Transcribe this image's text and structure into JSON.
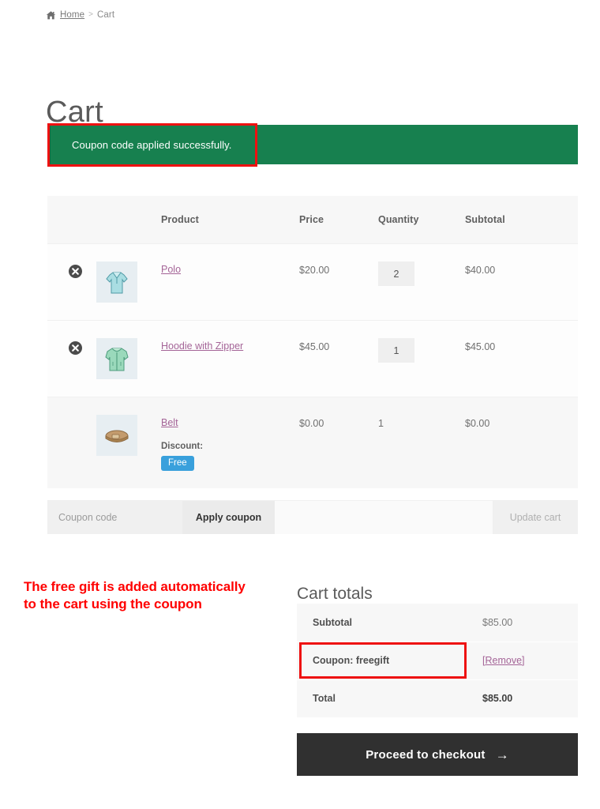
{
  "breadcrumb": {
    "home_label": "Home",
    "separator": ">",
    "current_label": "Cart"
  },
  "page_title": "Cart",
  "notice": {
    "message": "Coupon code applied successfully.",
    "background_color": "#17804f"
  },
  "annotation": {
    "text": "The free gift is added automatically to the cart using the coupon",
    "color": "#ff0000",
    "box_color": "#ee1111"
  },
  "cart_table": {
    "headers": {
      "remove": "",
      "thumbnail": "",
      "product": "Product",
      "price": "Price",
      "quantity": "Quantity",
      "subtotal": "Subtotal"
    },
    "rows": [
      {
        "name": "Polo",
        "price": "$20.00",
        "quantity": "2",
        "subtotal": "$40.00",
        "removable": true,
        "discount_label": "",
        "badge": "",
        "thumb_color": "#9ed8dd"
      },
      {
        "name": "Hoodie with Zipper",
        "price": "$45.00",
        "quantity": "1",
        "subtotal": "$45.00",
        "removable": true,
        "discount_label": "",
        "badge": "",
        "thumb_color": "#8ed9b8"
      },
      {
        "name": "Belt",
        "price": "$0.00",
        "quantity": "1",
        "subtotal": "$0.00",
        "removable": false,
        "discount_label": "Discount:",
        "badge": "Free",
        "badge_color": "#39a0dc",
        "thumb_color": "#c8a678"
      }
    ]
  },
  "toolbar": {
    "coupon_placeholder": "Coupon code",
    "coupon_value": "",
    "apply_label": "Apply coupon",
    "update_label": "Update cart"
  },
  "totals": {
    "title": "Cart totals",
    "rows": [
      {
        "label": "Subtotal",
        "value": "$85.00",
        "strong": false
      },
      {
        "label": "Coupon: freegift",
        "value": "[Remove]",
        "strong": false
      },
      {
        "label": "Total",
        "value": "$85.00",
        "strong": true
      }
    ],
    "remove_open_bracket": "[",
    "remove_link_label": "Remove",
    "remove_close_bracket": "]"
  },
  "checkout": {
    "label": "Proceed to checkout",
    "arrow": "→",
    "background_color": "#303030"
  }
}
